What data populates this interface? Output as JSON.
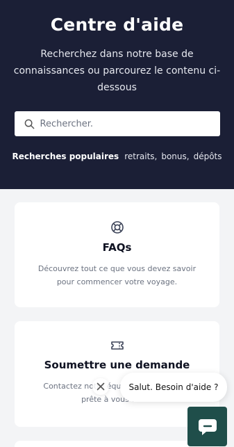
{
  "hero": {
    "title": "Centre d'aide",
    "subtitle": "Recherchez dans notre base de connaissances ou parcourez le contenu ci-dessous"
  },
  "search": {
    "placeholder": "Rechercher.",
    "icon": "search-icon"
  },
  "popular": {
    "label": "Recherches populaires",
    "tags": [
      "retraits,",
      "bonus,",
      "dépôts"
    ]
  },
  "cards": [
    {
      "title": "FAQs",
      "description": "Découvrez tout ce que vous devez savoir pour commencer votre voyage.",
      "icon": "lifebuoy-icon"
    },
    {
      "title": "Soumettre une demande",
      "description": "Contactez notre équipe, nous sommes prête à vous aider.",
      "icon": "ticket-icon"
    }
  ],
  "chat": {
    "greeting": "Salut. Besoin d'aide ?",
    "close_icon": "close-icon",
    "launcher_icon": "chat-icon"
  },
  "colors": {
    "hero_bg": "#1b1f36",
    "page_bg": "#f3f4f6",
    "launcher_bg": "#1f4e4a"
  }
}
